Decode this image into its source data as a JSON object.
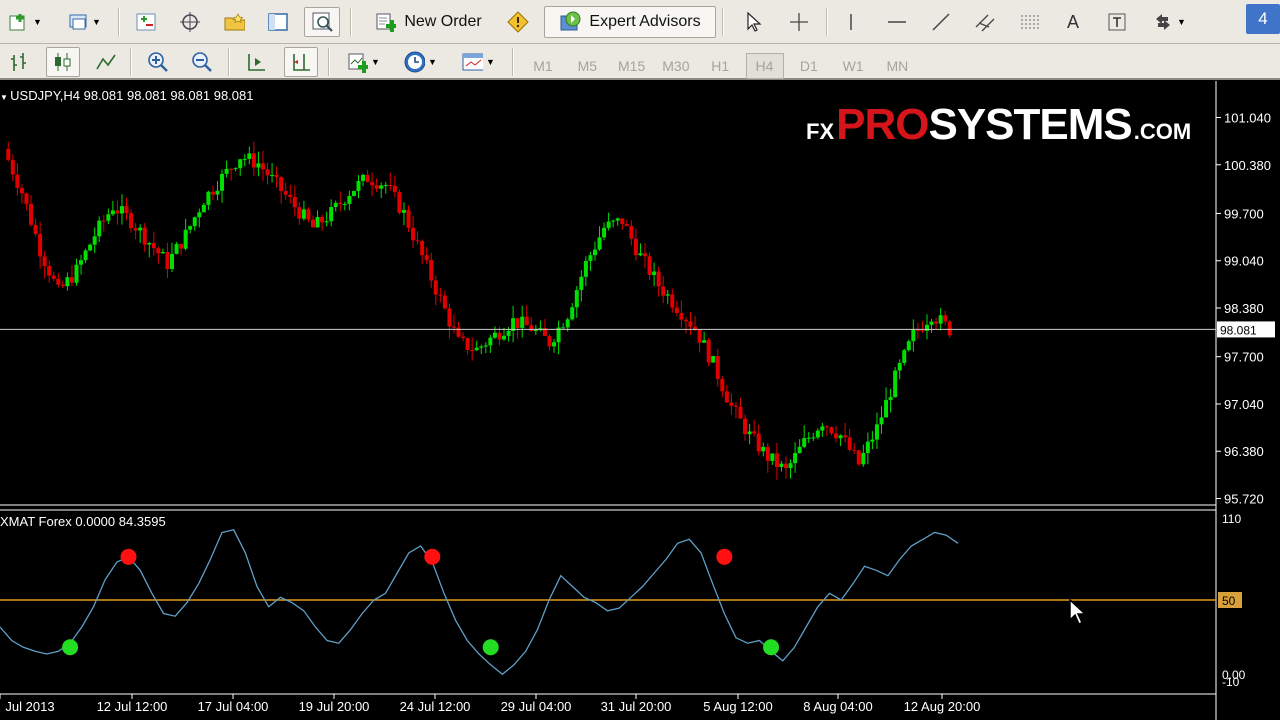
{
  "window": {
    "button_label": "4"
  },
  "toolbar1": {
    "new_order_label": "New Order",
    "expert_advisors_label": "Expert Advisors",
    "text_tool_label": "A"
  },
  "toolbar2": {
    "timeframes": [
      "M1",
      "M5",
      "M15",
      "M30",
      "H1",
      "H4",
      "D1",
      "W1",
      "MN"
    ],
    "active_timeframe": "H4"
  },
  "chart": {
    "header": "USDJPY,H4  98.081 98.081 98.081 98.081",
    "current_price": "98.081",
    "price_ticks": [
      "101.040",
      "100.380",
      "99.700",
      "99.040",
      "98.380",
      "97.700",
      "97.040",
      "96.380",
      "95.720"
    ],
    "time_ticks": [
      "Jul 2013",
      "12 Jul 12:00",
      "17 Jul 04:00",
      "19 Jul 20:00",
      "24 Jul 12:00",
      "29 Jul 04:00",
      "31 Jul 20:00",
      "5 Aug 12:00",
      "8 Aug 04:00",
      "12 Aug 20:00"
    ],
    "colors": {
      "bull": "#00e000",
      "bear": "#e00000",
      "grid_line": "#cfcfcf",
      "indicator_line": "#5f9fc8",
      "level_line": "#e59a1f",
      "buy_dot": "#22dd22",
      "sell_dot": "#ff1111"
    }
  },
  "logo": {
    "fx": "FX",
    "pro": "PRO",
    "systems": "SYSTEMS",
    "domain": ".COM"
  },
  "indicator": {
    "header": "XMAT Forex 0.0000 84.3595",
    "scale_top": "110",
    "level_label": "50",
    "scale_bottom_a": "0.00",
    "scale_bottom_b": "-10"
  },
  "chart_data": [
    {
      "type": "line",
      "title": "USDJPY,H4",
      "ylim": [
        95.72,
        101.04
      ],
      "y_ticks": [
        101.04,
        100.38,
        99.7,
        99.04,
        98.38,
        97.7,
        97.04,
        96.38,
        95.72
      ],
      "x_tick_labels": [
        "Jul 2013",
        "12 Jul 12:00",
        "17 Jul 04:00",
        "19 Jul 20:00",
        "24 Jul 12:00",
        "29 Jul 04:00",
        "31 Jul 20:00",
        "5 Aug 12:00",
        "8 Aug 04:00",
        "12 Aug 20:00"
      ],
      "series": [
        {
          "values": [
            100.6,
            100.0,
            99.2,
            98.6,
            98.9,
            99.4,
            99.8,
            99.6,
            99.3,
            99.0,
            99.4,
            99.9,
            100.2,
            100.5,
            100.4,
            100.1,
            99.8,
            99.5,
            99.7,
            100.0,
            100.2,
            100.1,
            99.7,
            99.1,
            98.5,
            97.9,
            97.8,
            98.0,
            98.2,
            98.1,
            97.9,
            98.3,
            99.0,
            99.5,
            99.6,
            99.1,
            98.7,
            98.4,
            98.1,
            97.6,
            97.0,
            96.6,
            96.3,
            96.1,
            96.5,
            96.8,
            96.6,
            96.2,
            96.7,
            97.4,
            98.0,
            98.3,
            98.08
          ]
        }
      ],
      "current_price": 98.081
    },
    {
      "type": "line",
      "title": "XMAT Forex",
      "ylim": [
        -10,
        110
      ],
      "levels": [
        50
      ],
      "series": [
        {
          "name": "XMAT Forex",
          "values": [
            30,
            20,
            15,
            12,
            10,
            12,
            18,
            30,
            45,
            65,
            78,
            82,
            72,
            55,
            40,
            38,
            48,
            62,
            80,
            100,
            102,
            85,
            60,
            45,
            52,
            48,
            42,
            30,
            20,
            18,
            28,
            40,
            50,
            55,
            70,
            85,
            90,
            78,
            55,
            35,
            20,
            10,
            2,
            -5,
            2,
            12,
            28,
            50,
            68,
            60,
            52,
            48,
            42,
            44,
            52,
            60,
            70,
            80,
            92,
            95,
            85,
            62,
            40,
            22,
            18,
            20,
            12,
            5,
            15,
            30,
            45,
            55,
            50,
            62,
            75,
            72,
            68,
            80,
            90,
            95,
            100,
            98,
            92
          ]
        }
      ],
      "buy_signals_at_index": [
        6,
        42,
        66
      ],
      "sell_signals_at_index": [
        11,
        37,
        62
      ],
      "buy_signal_value": 15,
      "sell_signal_value": 82
    }
  ]
}
